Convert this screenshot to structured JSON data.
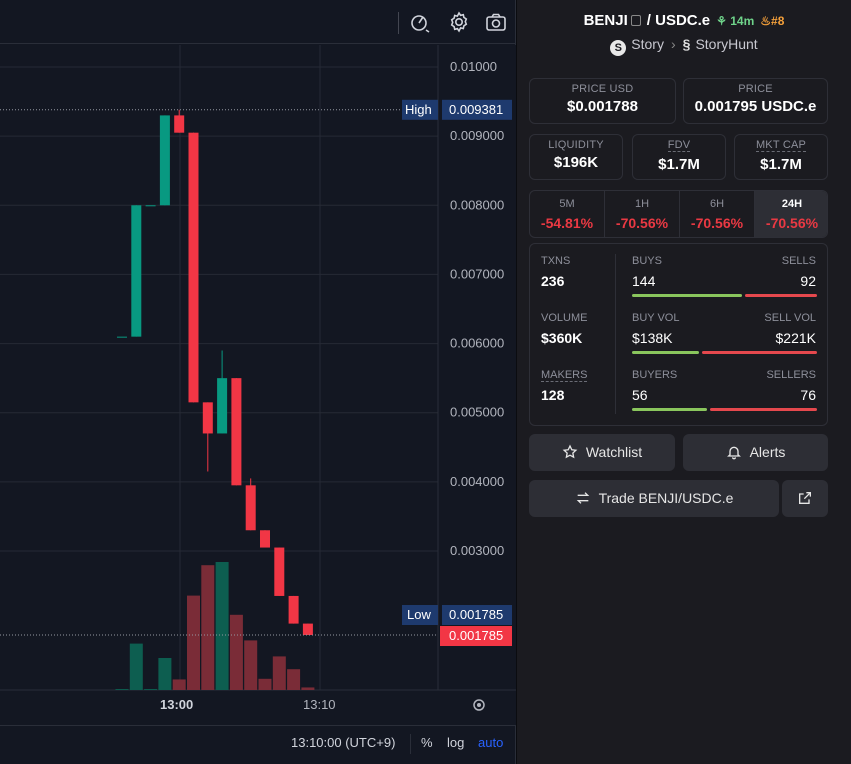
{
  "chart": {
    "price_ticks": [
      "0.01000",
      "0.009000",
      "0.008000",
      "0.007000",
      "0.006000",
      "0.005000",
      "0.004000",
      "0.003000"
    ],
    "high_label": "High",
    "high_value": "0.009381",
    "low_label": "Low",
    "low_value": "0.001785",
    "last_value": "0.001785",
    "time_ticks": [
      "13:00",
      "13:10"
    ],
    "footer": {
      "time": "13:10:00 (UTC+9)",
      "percent": "%",
      "log": "log",
      "auto": "auto"
    },
    "colors": {
      "up": "#089981",
      "down": "#f23645",
      "bg": "#131722",
      "grid": "#262a35"
    },
    "chart_data": {
      "type": "candlestick",
      "candles": [
        {
          "o": 0.0061,
          "h": 0.0061,
          "l": 0.0061,
          "c": 0.0061
        },
        {
          "o": 0.0061,
          "h": 0.008,
          "l": 0.0061,
          "c": 0.008
        },
        {
          "o": 0.008,
          "h": 0.008,
          "l": 0.008,
          "c": 0.008
        },
        {
          "o": 0.008,
          "h": 0.0093,
          "l": 0.008,
          "c": 0.0093
        },
        {
          "o": 0.0093,
          "h": 0.009381,
          "l": 0.00905,
          "c": 0.00905
        },
        {
          "o": 0.00905,
          "h": 0.00905,
          "l": 0.00515,
          "c": 0.00515
        },
        {
          "o": 0.00515,
          "h": 0.00515,
          "l": 0.00415,
          "c": 0.0047
        },
        {
          "o": 0.0047,
          "h": 0.0059,
          "l": 0.0047,
          "c": 0.0055
        },
        {
          "o": 0.0055,
          "h": 0.0055,
          "l": 0.00395,
          "c": 0.00395
        },
        {
          "o": 0.00395,
          "h": 0.00405,
          "l": 0.0033,
          "c": 0.0033
        },
        {
          "o": 0.0033,
          "h": 0.0033,
          "l": 0.00305,
          "c": 0.00305
        },
        {
          "o": 0.00305,
          "h": 0.00305,
          "l": 0.00235,
          "c": 0.00235
        },
        {
          "o": 0.00235,
          "h": 0.00235,
          "l": 0.00195,
          "c": 0.00195
        },
        {
          "o": 0.00195,
          "h": 0.00195,
          "l": 0.001785,
          "c": 0.001785
        }
      ],
      "volume": [
        {
          "v": 0.3,
          "up": true
        },
        {
          "v": 14.5,
          "up": true
        },
        {
          "v": 0.3,
          "up": true
        },
        {
          "v": 10.0,
          "up": true
        },
        {
          "v": 3.3,
          "up": false
        },
        {
          "v": 29.5,
          "up": false
        },
        {
          "v": 39.0,
          "up": false
        },
        {
          "v": 40.0,
          "up": true
        },
        {
          "v": 23.5,
          "up": false
        },
        {
          "v": 15.5,
          "up": false
        },
        {
          "v": 3.5,
          "up": false
        },
        {
          "v": 10.5,
          "up": false
        },
        {
          "v": 6.5,
          "up": false
        },
        {
          "v": 0.8,
          "up": false
        }
      ],
      "ylim": [
        0.0013,
        0.0104
      ]
    }
  },
  "pair": {
    "base": "BENJI",
    "quote": "USDC.e",
    "age": "14m",
    "rank": "#8",
    "chain": "Story",
    "dex": "StoryHunt"
  },
  "prices": {
    "price_usd_label": "PRICE USD",
    "price_usd": "$0.001788",
    "price_label": "PRICE",
    "price": "0.001795 USDC.e"
  },
  "metrics": {
    "liquidity_label": "LIQUIDITY",
    "liquidity": "$196K",
    "fdv_label": "FDV",
    "fdv": "$1.7M",
    "mktcap_label": "MKT CAP",
    "mktcap": "$1.7M"
  },
  "timeframes": [
    {
      "label": "5M",
      "value": "-54.81%"
    },
    {
      "label": "1H",
      "value": "-70.56%"
    },
    {
      "label": "6H",
      "value": "-70.56%"
    },
    {
      "label": "24H",
      "value": "-70.56%",
      "active": true
    }
  ],
  "stats": {
    "txns_label": "TXNS",
    "txns": "236",
    "buys_label": "BUYS",
    "buys": "144",
    "sells_label": "SELLS",
    "sells": "92",
    "buys_share": 0.61,
    "volume_label": "VOLUME",
    "volume": "$360K",
    "buy_vol_label": "BUY VOL",
    "buy_vol": "$138K",
    "sell_vol_label": "SELL VOL",
    "sell_vol": "$221K",
    "buy_vol_share": 0.38,
    "makers_label": "MAKERS",
    "makers": "128",
    "buyers_label": "BUYERS",
    "buyers": "56",
    "sellers_label": "SELLERS",
    "sellers": "76",
    "buyers_share": 0.42
  },
  "actions": {
    "watchlist": "Watchlist",
    "alerts": "Alerts",
    "trade": "Trade BENJI/USDC.e"
  },
  "icons": [
    "speed-icon",
    "gear-icon",
    "camera-icon",
    "copy-icon",
    "sprout-icon",
    "flame-icon",
    "story-logo-icon",
    "chevron-right-icon",
    "storyhunt-logo-icon",
    "star-icon",
    "bell-icon",
    "swap-arrows-icon",
    "external-link-icon",
    "chart-settings-icon"
  ]
}
